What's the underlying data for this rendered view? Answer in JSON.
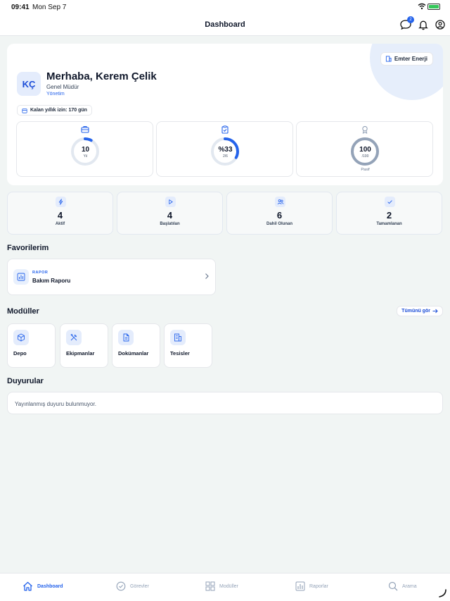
{
  "status_bar": {
    "time": "09:41",
    "date": "Mon Sep 7"
  },
  "nav": {
    "title": "Dashboard",
    "message_badge": "2"
  },
  "profile": {
    "company": "Emter Enerji",
    "initials": "KÇ",
    "greeting": "Merhaba, Kerem Çelik",
    "role": "Genel Müdür",
    "department": "Yönetim",
    "leave": "Kalan yıllık izin: 170 gün",
    "metrics": [
      {
        "icon": "briefcase-icon",
        "value": "10",
        "sub": "Yıl",
        "under": "",
        "progress": 0.08
      },
      {
        "icon": "clipboard-check-icon",
        "value": "%33",
        "sub": "2/6",
        "under": "",
        "progress": 0.33
      },
      {
        "icon": "award-icon",
        "value": "100",
        "sub": "/100",
        "under": "Pasif",
        "progress": 1.0
      }
    ]
  },
  "stats": [
    {
      "icon": "bolt-icon",
      "value": "4",
      "label": "Aktif"
    },
    {
      "icon": "play-icon",
      "value": "4",
      "label": "Başlatılan"
    },
    {
      "icon": "users-icon",
      "value": "6",
      "label": "Dahil Olunan"
    },
    {
      "icon": "check-icon",
      "value": "2",
      "label": "Tamamlanan"
    }
  ],
  "favorites": {
    "title": "Favorilerim",
    "items": [
      {
        "type": "RAPOR",
        "name": "Bakım Raporu"
      }
    ]
  },
  "modules": {
    "title": "Modüller",
    "see_all": "Tümünü gör",
    "items": [
      {
        "icon": "box-icon",
        "label": "Depo"
      },
      {
        "icon": "tools-icon",
        "label": "Ekipmanlar"
      },
      {
        "icon": "document-icon",
        "label": "Dokümanlar"
      },
      {
        "icon": "building-icon",
        "label": "Tesisler"
      }
    ]
  },
  "announcements": {
    "title": "Duyurular",
    "empty_text": "Yayınlanmış duyuru bulunmuyor."
  },
  "tabs": [
    {
      "icon": "home-icon",
      "label": "Dashboard",
      "active": true
    },
    {
      "icon": "check-circle-icon",
      "label": "Görevler",
      "active": false
    },
    {
      "icon": "grid-icon",
      "label": "Modüller",
      "active": false
    },
    {
      "icon": "bar-chart-icon",
      "label": "Raporlar",
      "active": false
    },
    {
      "icon": "search-icon",
      "label": "Arama",
      "active": false
    }
  ],
  "colors": {
    "accent": "#2563eb",
    "ring_track": "#e2e8f0",
    "ring_passive": "#94a3b8",
    "background": "#f1f5f4"
  }
}
